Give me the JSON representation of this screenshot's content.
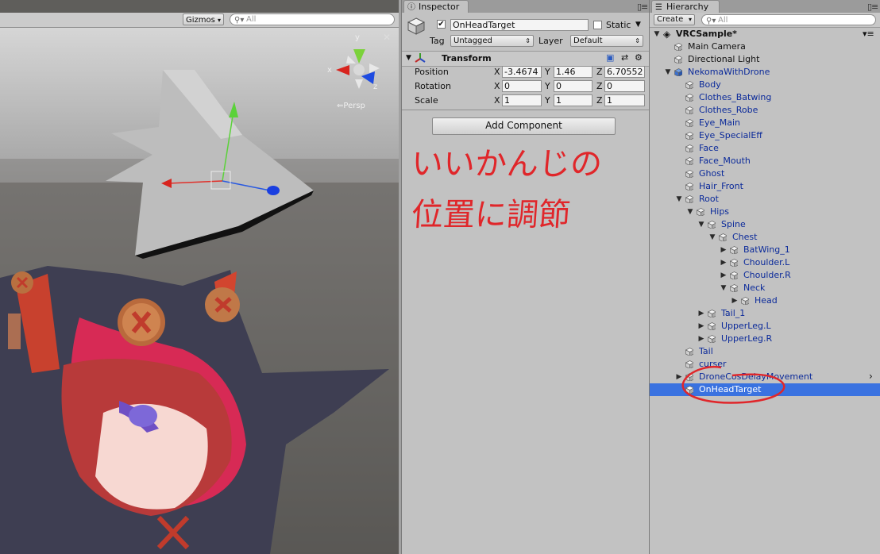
{
  "scene": {
    "gizmos_label": "Gizmos",
    "search_placeholder": "All",
    "persp_label": "Persp",
    "axis_x": "x",
    "axis_y": "y",
    "axis_z": "z"
  },
  "inspector": {
    "tab_label": "Inspector",
    "object_name": "OnHeadTarget",
    "active_checked": true,
    "static_label": "Static",
    "tag_label": "Tag",
    "tag_value": "Untagged",
    "layer_label": "Layer",
    "layer_value": "Default",
    "transform_title": "Transform",
    "position_label": "Position",
    "rotation_label": "Rotation",
    "scale_label": "Scale",
    "x_label": "X",
    "y_label": "Y",
    "z_label": "Z",
    "position": {
      "x": "-3.4674",
      "y": "1.46",
      "z": "6.70552"
    },
    "rotation": {
      "x": "0",
      "y": "0",
      "z": "0"
    },
    "scale": {
      "x": "1",
      "y": "1",
      "z": "1"
    },
    "add_component_label": "Add Component",
    "annotation_line1": "いいかんじの",
    "annotation_line2": "位置に調節",
    "annotation_color": "#e0262a"
  },
  "hierarchy": {
    "tab_label": "Hierarchy",
    "create_label": "Create",
    "search_placeholder": "All",
    "scene_name": "VRCSample*",
    "items": [
      {
        "label": "Main Camera",
        "depth": 1,
        "fold": "",
        "blue": false,
        "selected": false
      },
      {
        "label": "Directional Light",
        "depth": 1,
        "fold": "",
        "blue": false,
        "selected": false
      },
      {
        "label": "NekomaWithDrone",
        "depth": 1,
        "fold": "open",
        "blue": true,
        "selected": false
      },
      {
        "label": "Body",
        "depth": 2,
        "fold": "",
        "blue": true,
        "selected": false
      },
      {
        "label": "Clothes_Batwing",
        "depth": 2,
        "fold": "",
        "blue": true,
        "selected": false
      },
      {
        "label": "Clothes_Robe",
        "depth": 2,
        "fold": "",
        "blue": true,
        "selected": false
      },
      {
        "label": "Eye_Main",
        "depth": 2,
        "fold": "",
        "blue": true,
        "selected": false
      },
      {
        "label": "Eye_SpecialEff",
        "depth": 2,
        "fold": "",
        "blue": true,
        "selected": false
      },
      {
        "label": "Face",
        "depth": 2,
        "fold": "",
        "blue": true,
        "selected": false
      },
      {
        "label": "Face_Mouth",
        "depth": 2,
        "fold": "",
        "blue": true,
        "selected": false
      },
      {
        "label": "Ghost",
        "depth": 2,
        "fold": "",
        "blue": true,
        "selected": false
      },
      {
        "label": "Hair_Front",
        "depth": 2,
        "fold": "",
        "blue": true,
        "selected": false
      },
      {
        "label": "Root",
        "depth": 2,
        "fold": "open",
        "blue": true,
        "selected": false
      },
      {
        "label": "Hips",
        "depth": 3,
        "fold": "open",
        "blue": true,
        "selected": false
      },
      {
        "label": "Spine",
        "depth": 4,
        "fold": "open",
        "blue": true,
        "selected": false
      },
      {
        "label": "Chest",
        "depth": 5,
        "fold": "open",
        "blue": true,
        "selected": false
      },
      {
        "label": "BatWing_1",
        "depth": 6,
        "fold": "closed",
        "blue": true,
        "selected": false
      },
      {
        "label": "Choulder.L",
        "depth": 6,
        "fold": "closed",
        "blue": true,
        "selected": false
      },
      {
        "label": "Choulder.R",
        "depth": 6,
        "fold": "closed",
        "blue": true,
        "selected": false
      },
      {
        "label": "Neck",
        "depth": 6,
        "fold": "open",
        "blue": true,
        "selected": false
      },
      {
        "label": "Head",
        "depth": 7,
        "fold": "closed",
        "blue": true,
        "selected": false
      },
      {
        "label": "Tail_1",
        "depth": 4,
        "fold": "closed",
        "blue": true,
        "selected": false
      },
      {
        "label": "UpperLeg.L",
        "depth": 4,
        "fold": "closed",
        "blue": true,
        "selected": false
      },
      {
        "label": "UpperLeg.R",
        "depth": 4,
        "fold": "closed",
        "blue": true,
        "selected": false
      },
      {
        "label": "Tail",
        "depth": 2,
        "fold": "",
        "blue": true,
        "selected": false
      },
      {
        "label": "curser",
        "depth": 2,
        "fold": "",
        "blue": true,
        "selected": false
      },
      {
        "label": "DroneCosDelayMovement",
        "depth": 2,
        "fold": "closed",
        "blue": true,
        "selected": false
      },
      {
        "label": "OnHeadTarget",
        "depth": 2,
        "fold": "",
        "blue": false,
        "selected": true
      }
    ]
  }
}
